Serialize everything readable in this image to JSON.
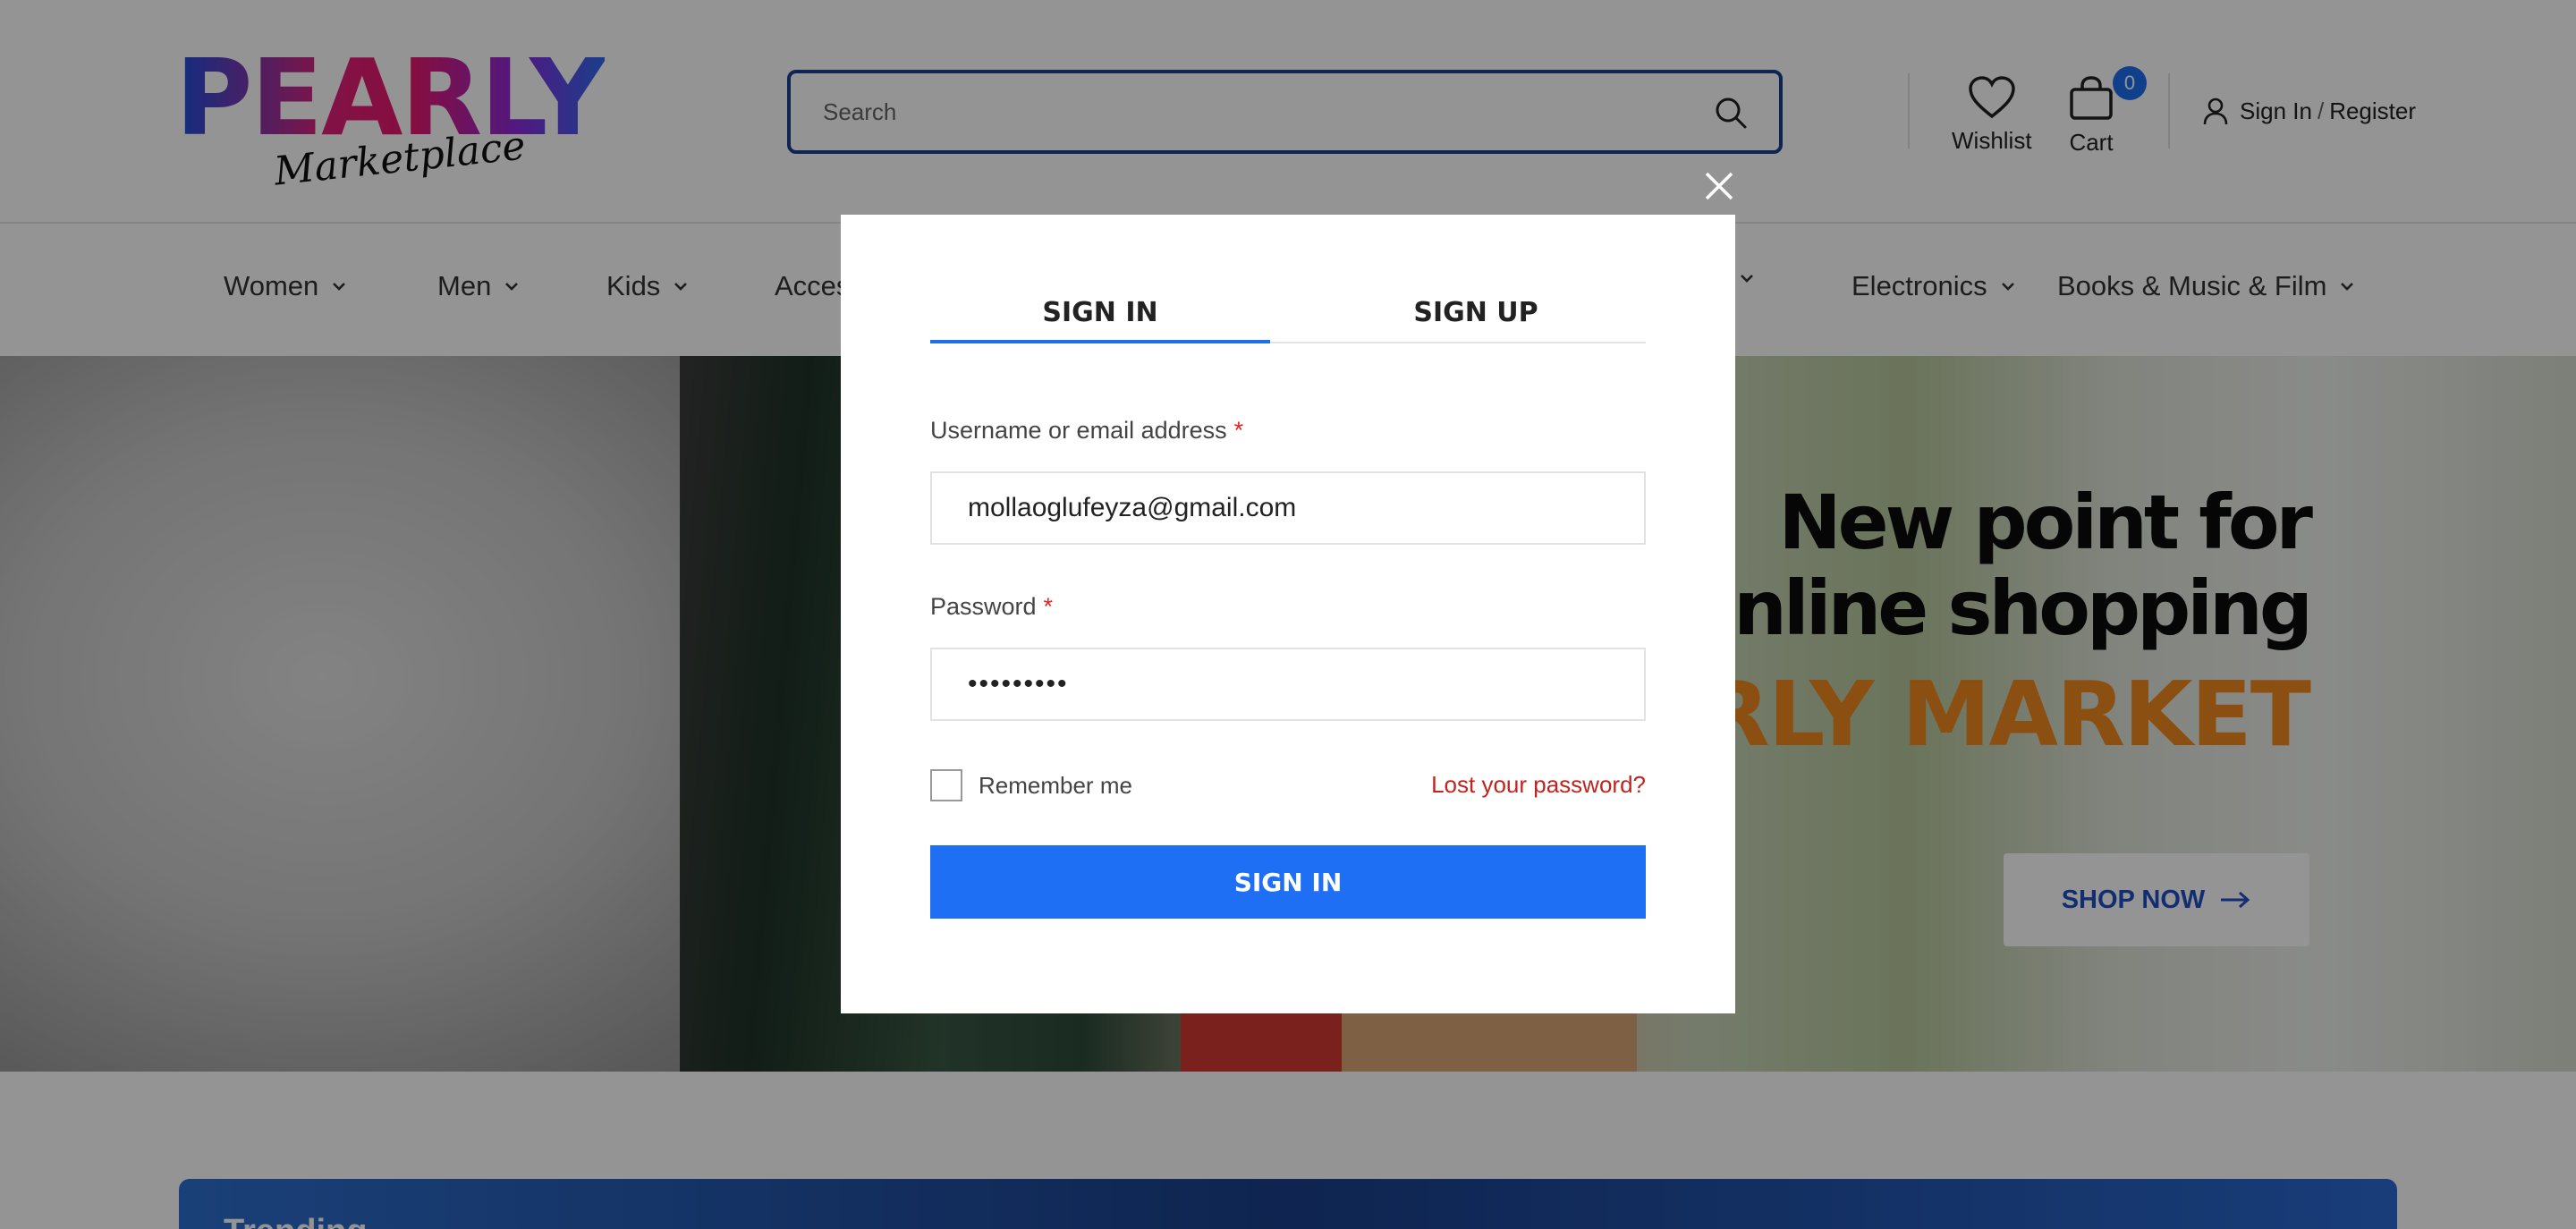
{
  "brand": {
    "name": "PEARLY",
    "tagline": "Marketplace"
  },
  "header": {
    "search_placeholder": "Search",
    "wishlist_label": "Wishlist",
    "cart_label": "Cart",
    "cart_count": "0",
    "sign_in_label": "Sign In",
    "separator": "/",
    "register_label": "Register"
  },
  "nav": {
    "items": [
      {
        "label": "Women"
      },
      {
        "label": "Men"
      },
      {
        "label": "Kids"
      },
      {
        "label": "Acces"
      },
      {
        "label": "Electronics"
      },
      {
        "label": "Books & Music & Film"
      }
    ]
  },
  "hero": {
    "line1": "New point for",
    "line2": "online shopping",
    "line3": "ARLY MARKET",
    "cta_label": "SHOP NOW"
  },
  "trending": {
    "title": "Trending"
  },
  "modal": {
    "tab_signin": "SIGN IN",
    "tab_signup": "SIGN UP",
    "username_label": "Username or email address",
    "username_value": "mollaoglufeyza@gmail.com",
    "password_label": "Password",
    "password_value": "•••••••••",
    "required_mark": "*",
    "remember_label": "Remember me",
    "lost_password_label": "Lost your password?",
    "submit_label": "SIGN IN"
  },
  "colors": {
    "accent": "#1f6ff5",
    "hero_orange": "#f08a1e",
    "link_red": "#c0241f",
    "search_border": "#1b3f8f"
  }
}
